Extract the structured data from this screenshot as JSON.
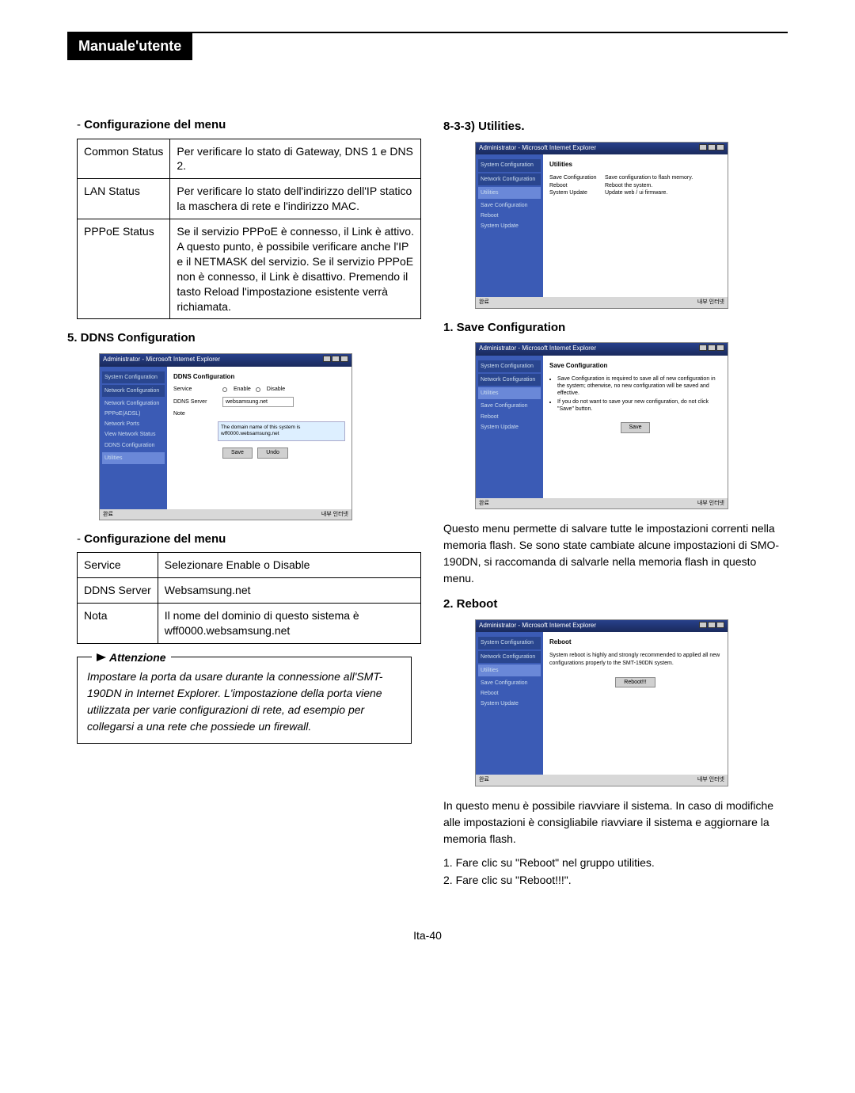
{
  "header": {
    "title": "Manuale'utente"
  },
  "left": {
    "menuConfig1": {
      "heading": "Configurazione del menu",
      "rows": [
        {
          "k": "Common\nStatus",
          "v": "Per verificare lo stato di Gateway, DNS 1 e DNS 2."
        },
        {
          "k": "LAN\nStatus",
          "v": "Per verificare lo stato dell'indirizzo dell'IP statico\nla maschera di rete e l'indirizzo MAC."
        },
        {
          "k": "PPPoE\nStatus",
          "v": "Se il servizio PPPoE è connesso, il Link è attivo. A questo punto, è possibile verificare anche l'IP e il NETMASK del servizio.\nSe il servizio PPPoE non è connesso, il Link è disattivo. Premendo il tasto Reload l'impostazione esistente verrà richiamata."
        }
      ]
    },
    "ddns": {
      "heading": "5. DDNS Configuration",
      "ss": {
        "title": "Administrator - Microsoft Internet Explorer",
        "sideGroups": [
          "System Configuration",
          "Network Configuration"
        ],
        "sideItems": [
          "Network Configuration",
          "PPPoE(ADSL)",
          "Network Ports",
          "View Network Status",
          "DDNS Configuration"
        ],
        "utilGroup": "Utilities",
        "mainTitle": "DDNS Configuration",
        "serviceLbl": "Service",
        "serviceEnable": "Enable",
        "serviceDisable": "Disable",
        "serverLbl": "DDNS Server",
        "serverVal": "websamsung.net",
        "noteLbl": "Note",
        "noteTxt": "The domain name of this system is wff0000.websamsung.net",
        "save": "Save",
        "undo": "Undo",
        "footerL": "완료",
        "footerR": "내부 인터넷"
      }
    },
    "menuConfig2": {
      "heading": "Configurazione del menu",
      "rows": [
        {
          "k": "Service",
          "v": "Selezionare Enable o Disable"
        },
        {
          "k": "DDNS\nServer",
          "v": "Websamsung.net"
        },
        {
          "k": "Nota",
          "v": "Il nome del dominio di questo sistema è wff0000.websamsung.net"
        }
      ]
    },
    "attention": {
      "label": "Attenzione",
      "text": "Impostare la porta da usare durante la connessione all'SMT-190DN in Internet Explorer. L'impostazione della porta viene utilizzata per varie configurazioni di rete, ad esempio per collegarsi a una rete che possiede un firewall."
    }
  },
  "right": {
    "utilities": {
      "heading": "8-3-3) Utilities.",
      "ss": {
        "title": "Administrator - Microsoft Internet Explorer",
        "sideGroups": [
          "System Configuration",
          "Network Configuration",
          "Utilities"
        ],
        "sideItems": [
          "Save Configuration",
          "Reboot",
          "System Update"
        ],
        "mainTitle": "Utilities",
        "tbl": [
          [
            "Save Configuration",
            "Save configuration to flash memory."
          ],
          [
            "Reboot",
            "Reboot the system."
          ],
          [
            "System Update",
            "Update web / ui firmware."
          ]
        ],
        "footerL": "완료",
        "footerR": "내부 인터넷"
      }
    },
    "save": {
      "heading": "1. Save Configuration",
      "ss": {
        "title": "Administrator - Microsoft Internet Explorer",
        "sideGroups": [
          "System Configuration",
          "Network Configuration",
          "Utilities"
        ],
        "sideItems": [
          "Save Configuration",
          "Reboot",
          "System Update"
        ],
        "mainTitle": "Save Configuration",
        "bullets": [
          "Save Configuration is required to save all of new configuration in the system; otherwise, no new configuration will be saved and effective.",
          "If you do not want to save your new configuration, do not click \"Save\" button."
        ],
        "btn": "Save",
        "footerL": "완료",
        "footerR": "내부 인터넷"
      },
      "para": "Questo menu permette di salvare tutte le impostazioni correnti nella memoria flash. Se sono state cambiate alcune impostazioni di SMO-190DN, si raccomanda di salvarle nella memoria flash in questo menu."
    },
    "reboot": {
      "heading": "2. Reboot",
      "ss": {
        "title": "Administrator - Microsoft Internet Explorer",
        "sideGroups": [
          "System Configuration",
          "Network Configuration",
          "Utilities"
        ],
        "sideItems": [
          "Save Configuration",
          "Reboot",
          "System Update"
        ],
        "mainTitle": "Reboot",
        "text": "System reboot is highly and strongly recommended to applied all new configurations properly to the SMT-190DN system.",
        "btn": "Reboot!!!",
        "footerL": "완료",
        "footerR": "내부 인터넷"
      },
      "para": "In questo menu è possibile riavviare il sistema. In caso di modifiche alle impostazioni è consigliabile riavviare il sistema e aggiornare la memoria flash.",
      "steps": [
        "1. Fare clic su \"Reboot\" nel gruppo utilities.",
        "2. Fare clic su \"Reboot!!!\"."
      ]
    }
  },
  "pageNum": "Ita-40"
}
